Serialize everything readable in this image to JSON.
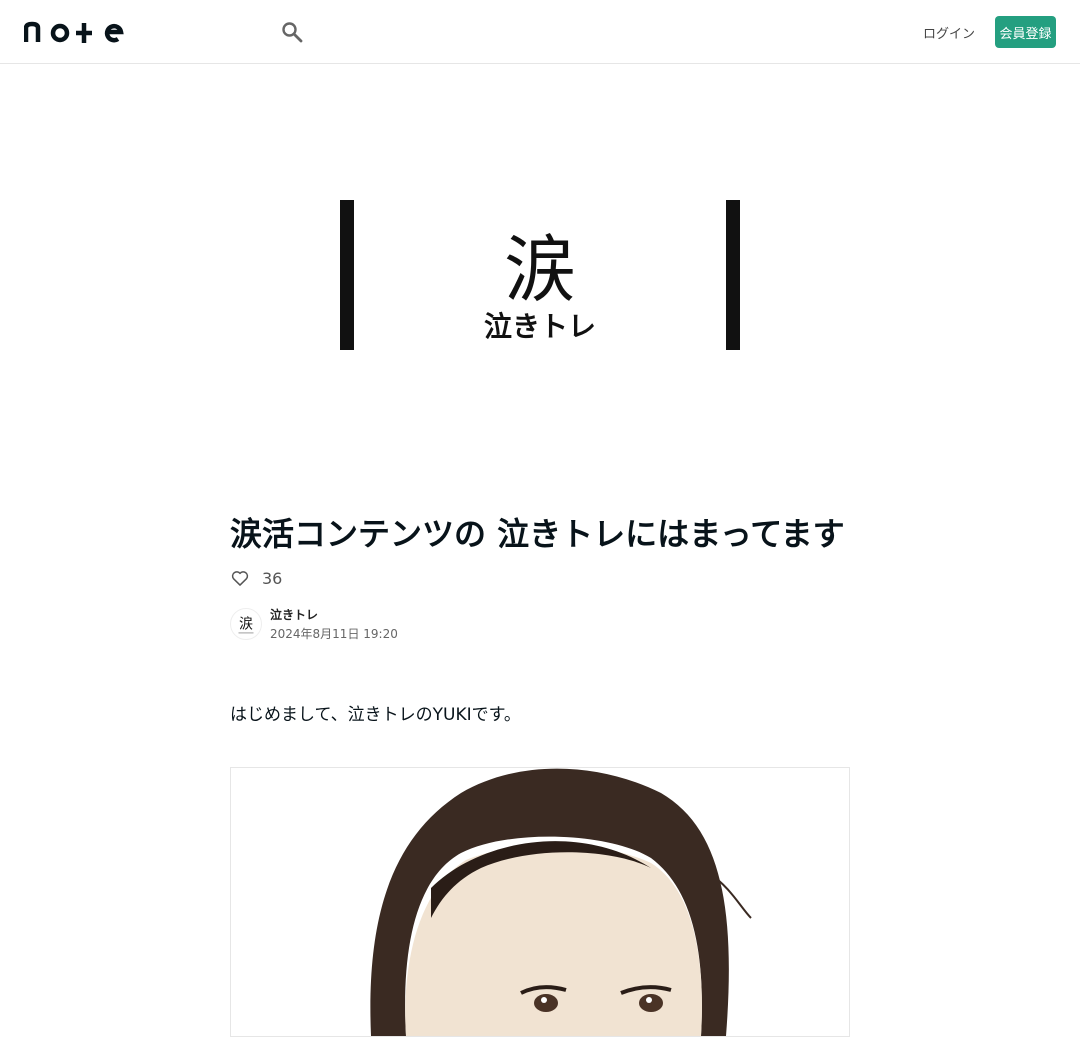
{
  "header": {
    "logo_text": "note",
    "login_label": "ログイン",
    "signup_label": "会員登録"
  },
  "eyecatch": {
    "kanji": "涙",
    "subtitle": "泣きトレ"
  },
  "article": {
    "title": "涙活コンテンツの 泣きトレにはまってます",
    "likes": "36",
    "author": "泣きトレ",
    "avatar_text": "涙",
    "date": "2024年8月11日 19:20",
    "intro": "はじめまして、泣きトレのYUKIです。"
  },
  "colors": {
    "accent": "#249f80",
    "text": "#08131a"
  }
}
